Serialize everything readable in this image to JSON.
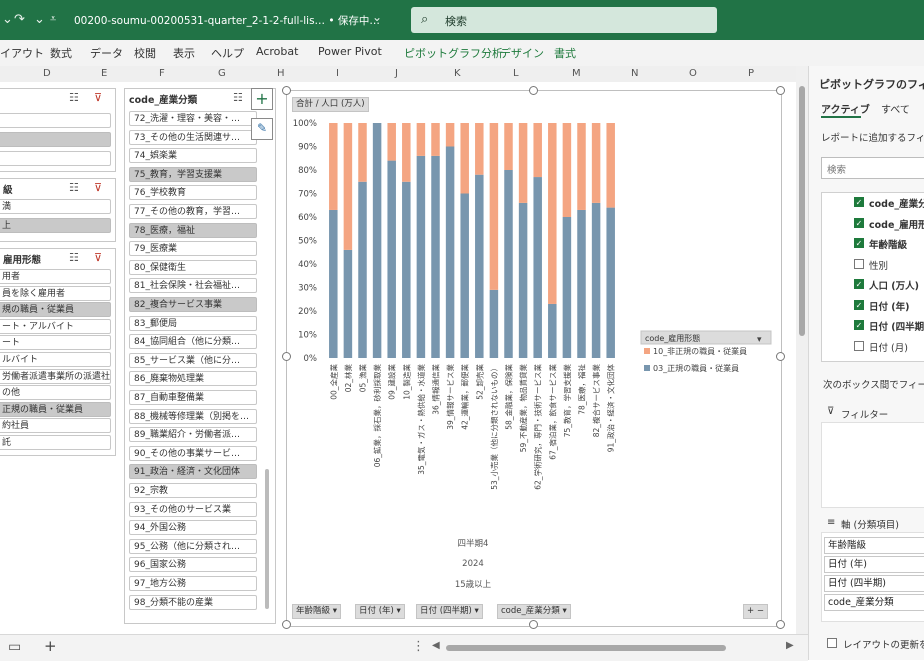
{
  "titlebar": {
    "filename": "00200-soumu-00200531-quarter_2-1-2-full-lis… • 保存中…",
    "search_placeholder": "検索"
  },
  "ribbon": {
    "tabs": [
      "イアウト",
      "数式",
      "データ",
      "校閲",
      "表示",
      "ヘルプ",
      "Acrobat",
      "Power Pivot",
      "ピボットグラフ分析",
      "デザイン",
      "書式"
    ]
  },
  "columns": [
    "D",
    "E",
    "F",
    "G",
    "H",
    "I",
    "J",
    "K",
    "L",
    "M",
    "N",
    "O",
    "P"
  ],
  "left_slicers": {
    "s1_items": [
      {
        "label": "",
        "sel": false
      },
      {
        "label": "",
        "sel": true
      },
      {
        "label": "",
        "sel": false
      }
    ],
    "s2_title": "級",
    "s2_items": [
      {
        "label": "満",
        "sel": false
      },
      {
        "label": "上",
        "sel": true
      }
    ],
    "s3_title": "雇用形態",
    "s3_items": [
      {
        "label": "用者",
        "sel": false
      },
      {
        "label": "員を除く雇用者",
        "sel": false
      },
      {
        "label": "規の職員・従業員",
        "sel": true
      },
      {
        "label": "ート・アルバイト",
        "sel": false
      },
      {
        "label": "ート",
        "sel": false
      },
      {
        "label": "ルバイト",
        "sel": false
      },
      {
        "label": "労働者派遣事業所の派遣社員",
        "sel": false
      },
      {
        "label": "の他",
        "sel": false
      },
      {
        "label": "正規の職員・従業員",
        "sel": true
      },
      {
        "label": "約社員",
        "sel": false
      },
      {
        "label": "託",
        "sel": false
      }
    ]
  },
  "industry_slicer": {
    "title": "code_産業分類",
    "items": [
      {
        "label": "72_洗濯・理容・美容・…",
        "sel": false
      },
      {
        "label": "73_その他の生活関連サ…",
        "sel": false
      },
      {
        "label": "74_娯楽業",
        "sel": false
      },
      {
        "label": "75_教育，学習支援業",
        "sel": true
      },
      {
        "label": "76_学校教育",
        "sel": false
      },
      {
        "label": "77_その他の教育，学習…",
        "sel": false
      },
      {
        "label": "78_医療，福祉",
        "sel": true
      },
      {
        "label": "79_医療業",
        "sel": false
      },
      {
        "label": "80_保健衛生",
        "sel": false
      },
      {
        "label": "81_社会保険・社会福祉…",
        "sel": false
      },
      {
        "label": "82_複合サービス事業",
        "sel": true
      },
      {
        "label": "83_郵便局",
        "sel": false
      },
      {
        "label": "84_協同組合（他に分類…",
        "sel": false
      },
      {
        "label": "85_サービス業（他に分…",
        "sel": false
      },
      {
        "label": "86_廃棄物処理業",
        "sel": false
      },
      {
        "label": "87_自動車整備業",
        "sel": false
      },
      {
        "label": "88_機械等修理業（別掲を…",
        "sel": false
      },
      {
        "label": "89_職業紹介・労働者派…",
        "sel": false
      },
      {
        "label": "90_その他の事業サービ…",
        "sel": false
      },
      {
        "label": "91_政治・経済・文化団体",
        "sel": true
      },
      {
        "label": "92_宗教",
        "sel": false
      },
      {
        "label": "93_その他のサービス業",
        "sel": false
      },
      {
        "label": "94_外国公務",
        "sel": false
      },
      {
        "label": "95_公務（他に分類され…",
        "sel": false
      },
      {
        "label": "96_国家公務",
        "sel": false
      },
      {
        "label": "97_地方公務",
        "sel": false
      },
      {
        "label": "98_分類不能の産業",
        "sel": false
      }
    ]
  },
  "chart_data": {
    "type": "bar",
    "stacked": true,
    "percent": true,
    "value_field_button": "合計 / 人口 (万人)",
    "yticks": [
      "100%",
      "90%",
      "80%",
      "70%",
      "60%",
      "50%",
      "40%",
      "30%",
      "20%",
      "10%",
      "0%"
    ],
    "categories": [
      "00_全産業",
      "02_林業",
      "05_漁業",
      "06_鉱業，採石業，砂利採取業",
      "09_建設業",
      "10_製造業",
      "35_電気・ガス・熱供給・水道業",
      "36_情報通信業",
      "39_情報サービス業",
      "42_運輸業，郵便業",
      "52_卸売業",
      "53_小売業（他に分類されないもの）",
      "58_金融業，保険業",
      "59_不動産業，物品賃貸業",
      "62_学術研究，専門・技術サービス業",
      "67_宿泊業，飲食サービス業",
      "75_教育，学習支援業",
      "78_医療，福祉",
      "82_複合サービス事業",
      "91_政治・経済・文化団体"
    ],
    "series": [
      {
        "name": "03_正規の職員・従業員",
        "color": "#7896ae",
        "values": [
          63,
          46,
          75,
          100,
          84,
          75,
          86,
          86,
          90,
          70,
          78,
          29,
          80,
          66,
          77,
          23,
          60,
          63,
          66,
          64
        ]
      },
      {
        "name": "10_非正規の職員・従業員",
        "color": "#f4a582",
        "values": [
          37,
          54,
          25,
          0,
          16,
          25,
          14,
          14,
          10,
          30,
          22,
          71,
          20,
          34,
          23,
          77,
          40,
          37,
          34,
          36
        ]
      }
    ],
    "xaxis_outer": [
      "四半期4",
      "2024",
      "15歳以上"
    ],
    "legend_title": "code_雇用形態",
    "legend_position": "right",
    "axis_buttons": [
      "年齢階級",
      "日付 (年)",
      "日付 (四半期)",
      "code_産業分類"
    ]
  },
  "pane": {
    "title": "ピボットグラフのフィー",
    "tab_active": "アクティブ",
    "tab_all": "すべて",
    "add_text": "レポートに追加するフィール",
    "search_placeholder": "検索",
    "fields": [
      {
        "label": "code_産業分",
        "checked": true
      },
      {
        "label": "code_雇用形",
        "checked": true
      },
      {
        "label": "年齢階級",
        "checked": true
      },
      {
        "label": "性別",
        "checked": false
      },
      {
        "label": "人口 (万人)",
        "checked": true
      },
      {
        "label": "日付 (年)",
        "checked": true
      },
      {
        "label": "日付 (四半期",
        "checked": true
      },
      {
        "label": "日付 (月)",
        "checked": false
      }
    ],
    "drag_text": "次のボックス間でフィールドを",
    "filter_label": "フィルター",
    "axis_label": "軸 (分類項目)",
    "axis_items": [
      "年齢階級",
      "日付 (年)",
      "日付 (四半期)",
      "code_産業分類"
    ],
    "defer_text": "レイアウトの更新を保"
  },
  "statusbar": {
    "add_sheet": "+"
  }
}
